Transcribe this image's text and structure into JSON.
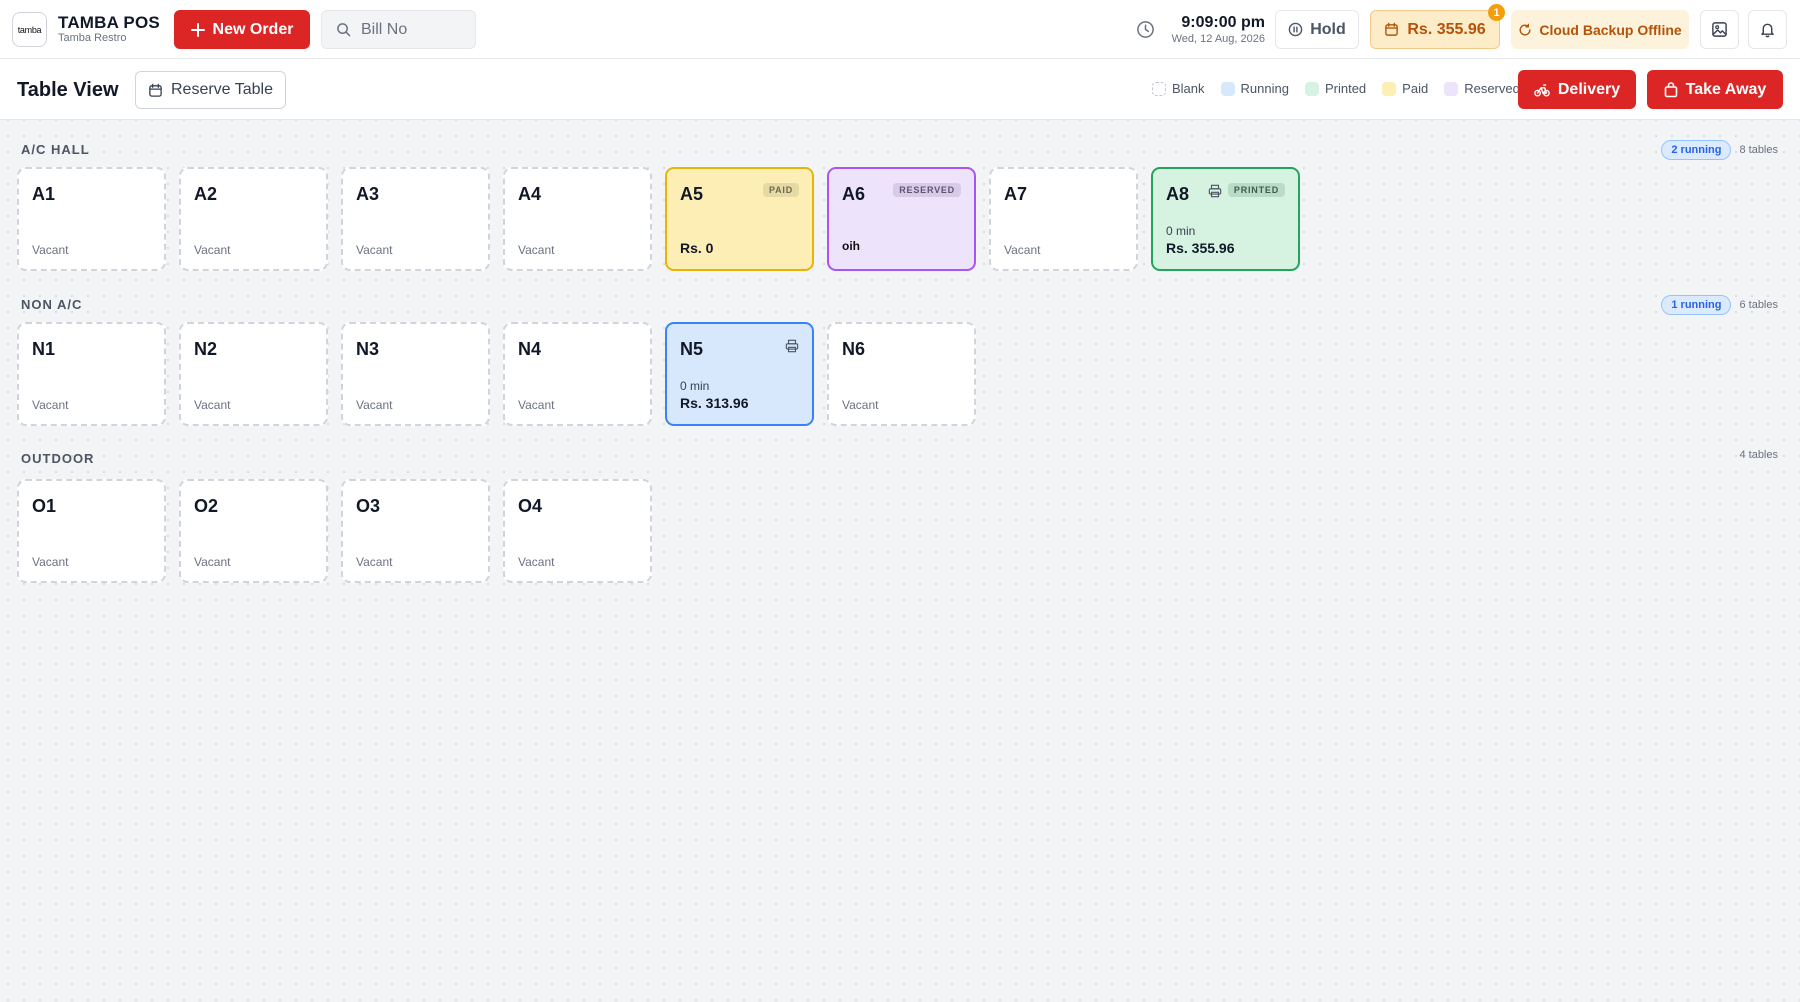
{
  "header": {
    "logo_text": "tamba",
    "brand_name": "TAMBA POS",
    "brand_sub": "Tamba Restro",
    "new_order_label": "New Order",
    "search_placeholder": "Bill No",
    "time": "9:09:00 pm",
    "date": "Wed, 12 Aug, 2026",
    "hold_label": "Hold",
    "amount_label": "Rs. 355.96",
    "amount_badge": "1",
    "cloud_label": "Cloud Backup Offline"
  },
  "subbar": {
    "title": "Table View",
    "reserve_label": "Reserve Table",
    "legend": [
      {
        "label": "Blank",
        "color": "#ffffff"
      },
      {
        "label": "Running",
        "color": "#d7e8fd"
      },
      {
        "label": "Printed",
        "color": "#d6f3e1"
      },
      {
        "label": "Paid",
        "color": "#fdeeb6"
      },
      {
        "label": "Reserved",
        "color": "#ede3fb"
      }
    ],
    "delivery_label": "Delivery",
    "takeaway_label": "Take Away"
  },
  "colors": {
    "accent_red": "#dc2626",
    "running": "#3b82f6",
    "printed": "#22a55b",
    "paid": "#eab308",
    "reserved": "#a855f7"
  },
  "sections": [
    {
      "title": "A/C HALL",
      "running": "2 running",
      "count": "8 tables",
      "tables": [
        {
          "name": "A1",
          "status": "blank",
          "sub": "Vacant"
        },
        {
          "name": "A2",
          "status": "blank",
          "sub": "Vacant"
        },
        {
          "name": "A3",
          "status": "blank",
          "sub": "Vacant"
        },
        {
          "name": "A4",
          "status": "blank",
          "sub": "Vacant"
        },
        {
          "name": "A5",
          "status": "paid",
          "badge": "PAID",
          "amount": "Rs. 0"
        },
        {
          "name": "A6",
          "status": "reserved",
          "badge": "RESERVED",
          "note": "oih"
        },
        {
          "name": "A7",
          "status": "blank",
          "sub": "Vacant"
        },
        {
          "name": "A8",
          "status": "printed",
          "badge": "PRINTED",
          "print_icon": true,
          "time": "0 min",
          "amount": "Rs. 355.96"
        }
      ]
    },
    {
      "title": "NON A/C",
      "running": "1 running",
      "count": "6 tables",
      "tables": [
        {
          "name": "N1",
          "status": "blank",
          "sub": "Vacant"
        },
        {
          "name": "N2",
          "status": "blank",
          "sub": "Vacant"
        },
        {
          "name": "N3",
          "status": "blank",
          "sub": "Vacant"
        },
        {
          "name": "N4",
          "status": "blank",
          "sub": "Vacant"
        },
        {
          "name": "N5",
          "status": "running",
          "print_icon": true,
          "time": "0 min",
          "amount": "Rs. 313.96"
        },
        {
          "name": "N6",
          "status": "blank",
          "sub": "Vacant"
        }
      ]
    },
    {
      "title": "OUTDOOR",
      "running": "",
      "count": "4 tables",
      "tables": [
        {
          "name": "O1",
          "status": "blank",
          "sub": "Vacant"
        },
        {
          "name": "O2",
          "status": "blank",
          "sub": "Vacant"
        },
        {
          "name": "O3",
          "status": "blank",
          "sub": "Vacant"
        },
        {
          "name": "O4",
          "status": "blank",
          "sub": "Vacant"
        }
      ]
    }
  ]
}
